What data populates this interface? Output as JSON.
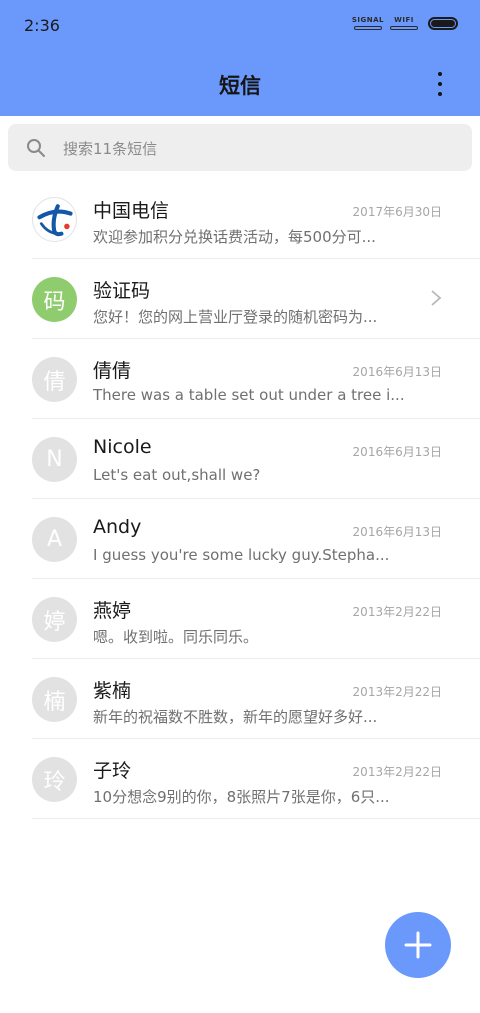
{
  "status_bar": {
    "time": "2:36",
    "signal_label": "SIGNAL",
    "wifi_label": "WIFI"
  },
  "header": {
    "title": "短信"
  },
  "search": {
    "placeholder": "搜索11条短信"
  },
  "conversations": [
    {
      "avatar": "",
      "name": "中国电信",
      "snippet": "欢迎参加积分兑换话费活动，每500分可...",
      "date": "2017年6月30日"
    },
    {
      "avatar": "码",
      "name": "验证码",
      "snippet": "您好！您的网上营业厅登录的随机密码为...",
      "date": ""
    },
    {
      "avatar": "倩",
      "name": "倩倩",
      "snippet": "There was a table set out under a tree i...",
      "date": "2016年6月13日"
    },
    {
      "avatar": "N",
      "name": "Nicole",
      "snippet": "Let's eat out,shall we?",
      "date": "2016年6月13日"
    },
    {
      "avatar": "A",
      "name": "Andy",
      "snippet": "I guess you're some lucky guy.Stepha...",
      "date": "2016年6月13日"
    },
    {
      "avatar": "婷",
      "name": "燕婷",
      "snippet": "嗯。收到啦。同乐同乐。",
      "date": "2013年2月22日"
    },
    {
      "avatar": "楠",
      "name": "紫楠",
      "snippet": "新年的祝福数不胜数，新年的愿望好多好...",
      "date": "2013年2月22日"
    },
    {
      "avatar": "玲",
      "name": "子玲",
      "snippet": "10分想念9别的你，8张照片7张是你，6只...",
      "date": "2013年2月22日"
    }
  ],
  "colors": {
    "accent": "#6b99fb",
    "verification_avatar": "#8fcc6e",
    "telecom_logo": "#1457a8"
  },
  "icons": {
    "search": "search-icon",
    "more": "more-vert-icon",
    "chevron": "chevron-right-icon",
    "fab": "plus-icon"
  }
}
